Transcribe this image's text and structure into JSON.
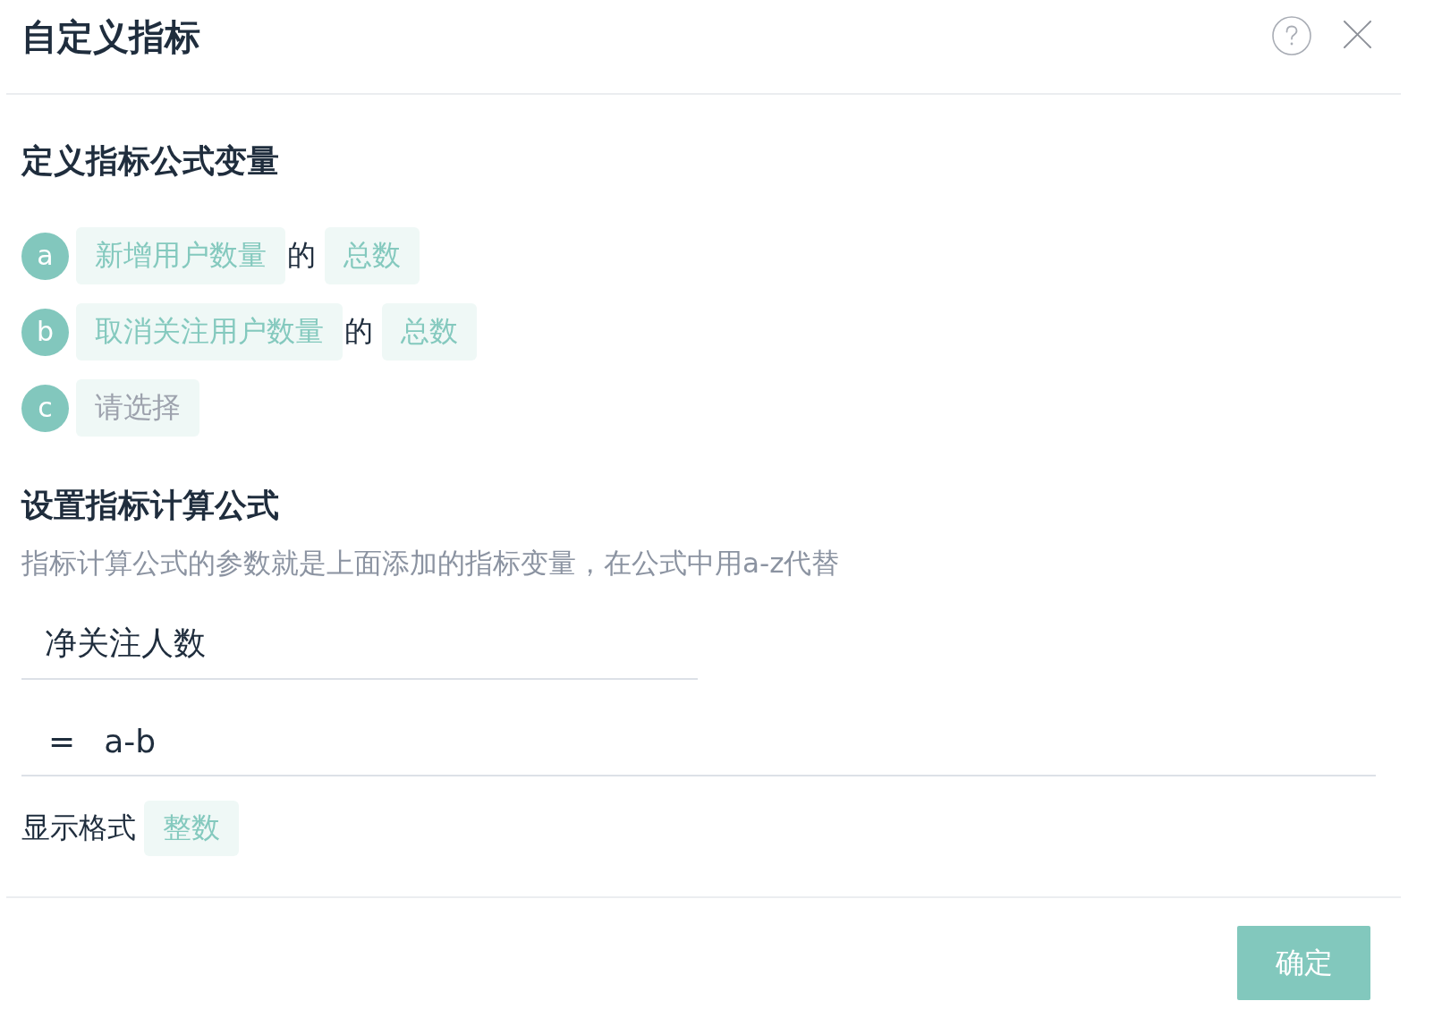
{
  "dialog": {
    "title": "自定义指标"
  },
  "variables_section": {
    "title": "定义指标公式变量",
    "variables": [
      {
        "letter": "a",
        "metric": "新增用户数量",
        "connector": "的",
        "aggregation": "总数"
      },
      {
        "letter": "b",
        "metric": "取消关注用户数量",
        "connector": "的",
        "aggregation": "总数"
      },
      {
        "letter": "c",
        "placeholder": "请选择"
      }
    ]
  },
  "formula_section": {
    "title": "设置指标计算公式",
    "description": "指标计算公式的参数就是上面添加的指标变量，在公式中用a-z代替",
    "name_field": {
      "value": "净关注人数"
    },
    "formula_field": {
      "operator": "=",
      "value": "a-b"
    },
    "display_format": {
      "label": "显示格式",
      "value": "整数"
    }
  },
  "footer": {
    "confirm_button": "确定"
  }
}
